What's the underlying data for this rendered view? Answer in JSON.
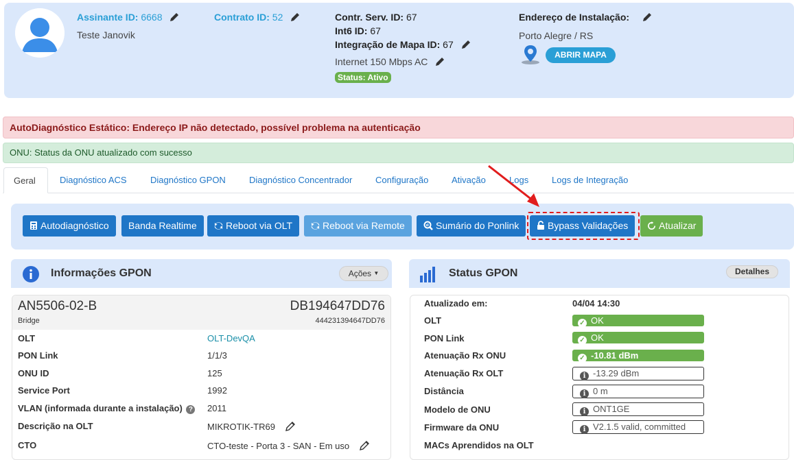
{
  "header": {
    "assinante_label": "Assinante ID:",
    "assinante_id": "6668",
    "assinante_name": "Teste Janovik",
    "contrato_label": "Contrato ID:",
    "contrato_id": "52",
    "contr_serv_label": "Contr. Serv. ID:",
    "contr_serv_id": "67",
    "int6_label": "Int6 ID:",
    "int6_id": "67",
    "integracao_label": "Integração de Mapa ID:",
    "integracao_id": "67",
    "plan": "Internet 150 Mbps AC",
    "status": "Status: Ativo",
    "endereco_label": "Endereço de Instalação:",
    "endereco_value": "Porto Alegre / RS",
    "map_button": "ABRIR MAPA"
  },
  "alerts": {
    "danger": "AutoDiagnóstico Estático: Endereço IP não detectado, possível problema na autenticação",
    "success": "ONU: Status da ONU atualizado com sucesso"
  },
  "tabs": [
    {
      "label": "Geral"
    },
    {
      "label": "Diagnóstico ACS"
    },
    {
      "label": "Diagnóstico GPON"
    },
    {
      "label": "Diagnóstico Concentrador"
    },
    {
      "label": "Configuração"
    },
    {
      "label": "Ativação"
    },
    {
      "label": "Logs"
    },
    {
      "label": "Logs de Integração"
    }
  ],
  "toolbar": {
    "autodiag": "Autodiagnóstico",
    "banda": "Banda Realtime",
    "reboot_olt": "Reboot via OLT",
    "reboot_remote": "Reboot via Remote",
    "sumario": "Sumário do Ponlink",
    "bypass": "Bypass Validações",
    "atualizar": "Atualizar"
  },
  "info_panel": {
    "title": "Informações GPON",
    "actions": "Ações",
    "model": "AN5506-02-B",
    "serial": "DB194647DD76",
    "mode": "Bridge",
    "serial_sub": "444231394647DD76",
    "rows": [
      {
        "label": "OLT",
        "value": "OLT-DevQA"
      },
      {
        "label": "PON Link",
        "value": "1/1/3"
      },
      {
        "label": "ONU ID",
        "value": "125"
      },
      {
        "label": "Service Port",
        "value": "1992"
      },
      {
        "label": "VLAN (informada durante a instalação)",
        "value": "2011"
      },
      {
        "label": "Descrição na OLT",
        "value": "MIKROTIK-TR69"
      },
      {
        "label": "CTO",
        "value": "CTO-teste - Porta 3 - SAN - Em uso"
      }
    ]
  },
  "status_panel": {
    "title": "Status GPON",
    "details": "Detalhes",
    "rows": [
      {
        "label": "Atualizado em:",
        "value": "04/04 14:30"
      },
      {
        "label": "OLT",
        "value": "OK"
      },
      {
        "label": "PON Link",
        "value": "OK"
      },
      {
        "label": "Atenuação Rx ONU",
        "value": "-10.81 dBm"
      },
      {
        "label": "Atenuação Rx OLT",
        "value": "-13.29 dBm"
      },
      {
        "label": "Distância",
        "value": "0 m"
      },
      {
        "label": "Modelo de ONU",
        "value": "ONT1GE"
      },
      {
        "label": "Firmware da ONU",
        "value": "V2.1.5 valid, committed"
      },
      {
        "label": "MACs Aprendidos na OLT",
        "value": ""
      }
    ]
  },
  "colors": {
    "primary": "#1f76c7",
    "success": "#6ab04c",
    "info_link": "#2a9fd6",
    "panel_bg": "#dbe8fb",
    "danger_bg": "#f8d7da",
    "success_bg": "#d4eddb",
    "annotation": "#e11d1d"
  }
}
